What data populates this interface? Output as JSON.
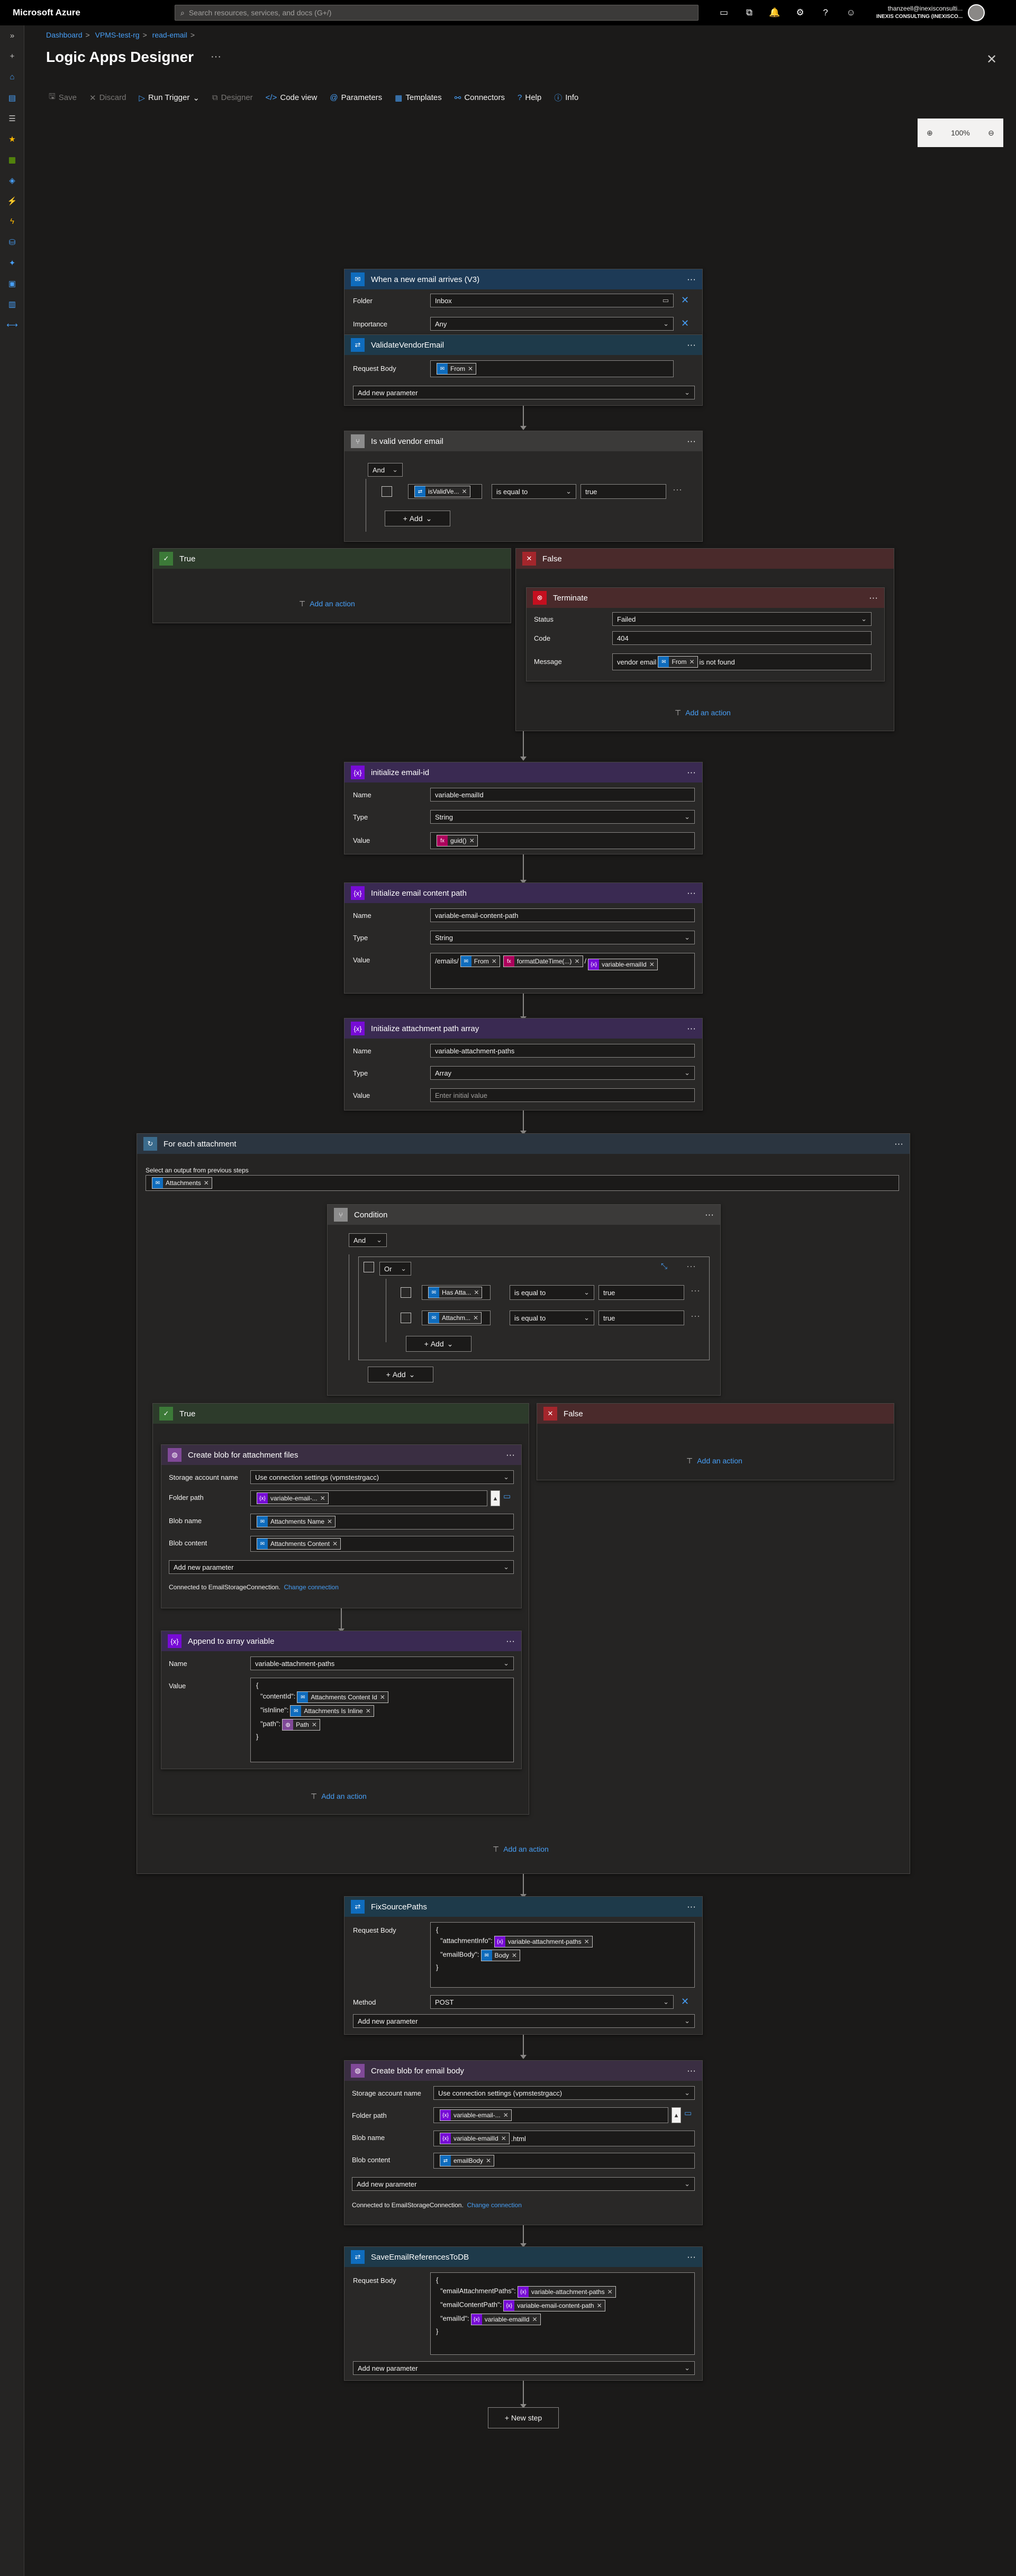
{
  "topbar": {
    "brand": "Microsoft Azure",
    "search_placeholder": "Search resources, services, and docs (G+/)",
    "account_email": "thanzeell@inexisconsulti...",
    "account_org": "INEXIS CONSULTING (INEXISCO..."
  },
  "breadcrumb": [
    "Dashboard",
    "VPMS-test-rg",
    "read-email"
  ],
  "page": {
    "title": "Logic Apps Designer"
  },
  "toolbar": {
    "save": "Save",
    "discard": "Discard",
    "run_trigger": "Run Trigger",
    "designer": "Designer",
    "code_view": "Code view",
    "parameters": "Parameters",
    "templates": "Templates",
    "connectors": "Connectors",
    "help": "Help",
    "info": "Info"
  },
  "zoom": "100%",
  "colors": {
    "outlook": "#0f6cbd",
    "variable": "#770bd6",
    "control": "#8c8c8c",
    "true_green": "#3c7a38",
    "false_red": "#a4262c",
    "http": "#3b6b8c",
    "storage": "#804998",
    "link": "#479ef5"
  },
  "trigger": {
    "title": "When a new email arrives (V3)",
    "folder_label": "Folder",
    "folder_value": "Inbox",
    "importance_label": "Importance",
    "importance_value": "Any"
  },
  "validate": {
    "title": "ValidateVendorEmail",
    "body_label": "Request Body",
    "token": "From",
    "add_param": "Add new parameter"
  },
  "isvalid": {
    "title": "Is valid vendor email",
    "and": "And",
    "token": "isValidVe...",
    "op": "is equal to",
    "value": "true",
    "add": "Add"
  },
  "branch1": {
    "true_label": "True",
    "false_label": "False",
    "add_action": "Add an action"
  },
  "terminate": {
    "title": "Terminate",
    "status_label": "Status",
    "status_value": "Failed",
    "code_label": "Code",
    "code_value": "404",
    "message_label": "Message",
    "message_pre": "vendor email",
    "message_token": "From",
    "message_post": "is not found"
  },
  "init1": {
    "title": "initialize email-id",
    "name_label": "Name",
    "name_value": "variable-emailId",
    "type_label": "Type",
    "type_value": "String",
    "value_label": "Value",
    "token": "guid()"
  },
  "init2": {
    "title": "Initialize email content path",
    "name_label": "Name",
    "name_value": "variable-email-content-path",
    "type_label": "Type",
    "type_value": "String",
    "value_label": "Value",
    "prefix": "/emails/",
    "token1": "From",
    "token2": "formatDateTime(...)",
    "slash": "/",
    "token3": "variable-emailId"
  },
  "init3": {
    "title": "Initialize attachment path array",
    "name_label": "Name",
    "name_value": "variable-attachment-paths",
    "type_label": "Type",
    "type_value": "Array",
    "value_label": "Value",
    "value_placeholder": "Enter initial value"
  },
  "foreach": {
    "title": "For each attachment",
    "select_label": "Select an output from previous steps",
    "token": "Attachments",
    "add_action": "Add an action"
  },
  "condition": {
    "title": "Condition",
    "and": "And",
    "or": "Or",
    "row1_token": "Has Atta...",
    "row2_token": "Attachm...",
    "op": "is equal to",
    "value": "true",
    "add": "Add"
  },
  "branch2": {
    "true_label": "True",
    "false_label": "False",
    "add_action": "Add an action"
  },
  "blob1": {
    "title": "Create blob for attachment files",
    "account_label": "Storage account name",
    "account_value": "Use connection settings (vpmstestrgacc)",
    "folder_label": "Folder path",
    "folder_token": "variable-email-...",
    "name_label": "Blob name",
    "name_token": "Attachments Name",
    "content_label": "Blob content",
    "content_token": "Attachments Content",
    "add_param": "Add new parameter",
    "connected": "Connected to EmailStorageConnection.",
    "change": "Change connection"
  },
  "append": {
    "title": "Append to array variable",
    "name_label": "Name",
    "name_value": "variable-attachment-paths",
    "value_label": "Value",
    "open": "{",
    "k1": "\"contentId\":",
    "t1": "Attachments Content Id",
    "k2": "\"isInline\":",
    "t2": "Attachments Is Inline",
    "k3": "\"path\":",
    "t3": "Path",
    "close": "}"
  },
  "fixsrc": {
    "title": "FixSourcePaths",
    "body_label": "Request Body",
    "open": "{",
    "k1": "\"attachmentInfo\":",
    "t1": "variable-attachment-paths",
    "k2": "\"emailBody\":",
    "t2": "Body",
    "close": "}",
    "method_label": "Method",
    "method_value": "POST",
    "add_param": "Add new parameter"
  },
  "blob2": {
    "title": "Create blob for email body",
    "account_label": "Storage account name",
    "account_value": "Use connection settings (vpmstestrgacc)",
    "folder_label": "Folder path",
    "folder_token": "variable-email-...",
    "name_label": "Blob name",
    "name_token": "variable-emailId",
    "name_suffix": ".html",
    "content_label": "Blob content",
    "content_token": "emailBody",
    "add_param": "Add new parameter",
    "connected": "Connected to EmailStorageConnection.",
    "change": "Change connection"
  },
  "save": {
    "title": "SaveEmailReferencesToDB",
    "body_label": "Request Body",
    "open": "{",
    "k1": "\"emailAttachmentPaths\":",
    "t1": "variable-attachment-paths",
    "k2": "\"emailContentPath\":",
    "t2": "variable-email-content-path",
    "k3": "\"emailId\":",
    "t3": "variable-emailId",
    "close": "}",
    "add_param": "Add new parameter"
  },
  "new_step": "+ New step"
}
